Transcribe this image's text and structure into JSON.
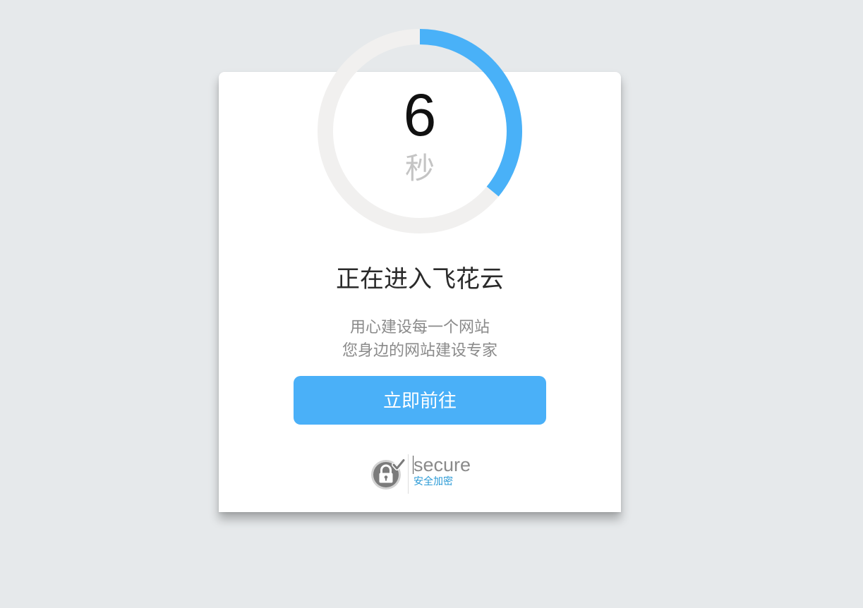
{
  "countdown": {
    "value": "6",
    "unit": "秒",
    "progress": 0.36,
    "track_color": "#f1f0ef",
    "fill_color": "#49b1f8"
  },
  "page": {
    "title": "正在进入飞花云",
    "subtitle_line1": "用心建设每一个网站",
    "subtitle_line2": "您身边的网站建设专家"
  },
  "actions": {
    "go_label": "立即前往"
  },
  "security_badge": {
    "icon": "lock-check-icon",
    "label": "secure",
    "label_cn": "安全加密"
  }
}
